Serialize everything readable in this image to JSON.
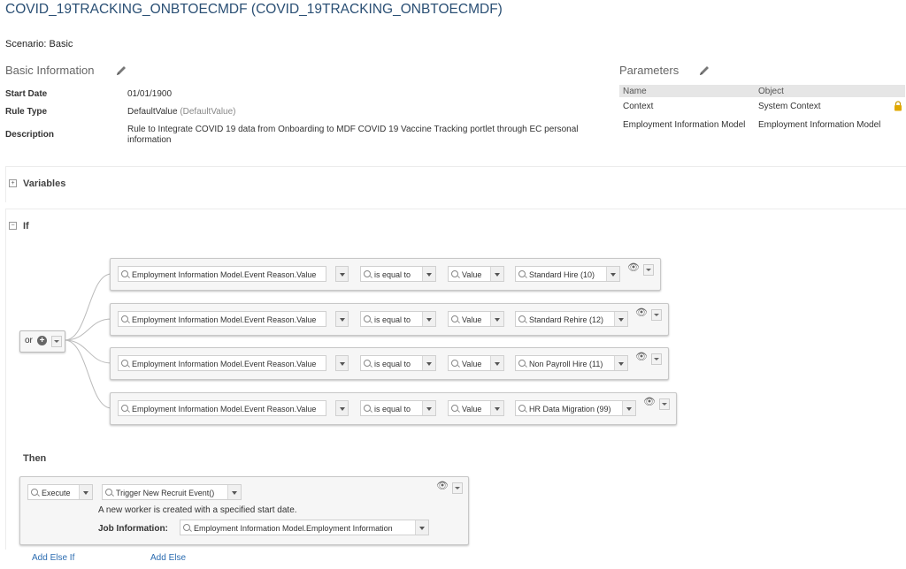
{
  "title": "COVID_19TRACKING_ONBTOECMDF (COVID_19TRACKING_ONBTOECMDF)",
  "scenario": "Scenario: Basic",
  "basic_info": {
    "heading": "Basic Information",
    "start_date_label": "Start Date",
    "start_date_value": "01/01/1900",
    "rule_type_label": "Rule Type",
    "rule_type_value": "DefaultValue",
    "rule_type_sub": "(DefaultValue)",
    "description_label": "Description",
    "description_value": "Rule to Integrate COVID 19 data from Onboarding to MDF COVID 19 Vaccine Tracking portlet through EC personal information"
  },
  "parameters": {
    "heading": "Parameters",
    "col_name": "Name",
    "col_object": "Object",
    "rows": [
      {
        "name": "Context",
        "object": "System Context"
      },
      {
        "name": "Employment Information Model",
        "object": "Employment Information Model"
      }
    ]
  },
  "variables": {
    "label": "Variables",
    "toggle": "+"
  },
  "if_section": {
    "label": "If",
    "toggle": "−",
    "operator": "or"
  },
  "conditions": [
    {
      "field": "Employment Information Model.Event Reason.Value",
      "op": "is equal to",
      "type": "Value",
      "value": "Standard Hire (10)"
    },
    {
      "field": "Employment Information Model.Event Reason.Value",
      "op": "is equal to",
      "type": "Value",
      "value": "Standard Rehire (12)"
    },
    {
      "field": "Employment Information Model.Event Reason.Value",
      "op": "is equal to",
      "type": "Value",
      "value": "Non Payroll Hire (11)"
    },
    {
      "field": "Employment Information Model.Event Reason.Value",
      "op": "is equal to",
      "type": "Value",
      "value": "HR Data Migration (99)"
    }
  ],
  "then": {
    "label": "Then",
    "action": "Execute",
    "function": "Trigger New Recruit Event()",
    "description": "A new worker is created with a specified start date.",
    "job_info_label": "Job Information:",
    "job_info_value": "Employment Information Model.Employment Information"
  },
  "links": {
    "add_else_if": "Add Else If",
    "add_else": "Add Else"
  },
  "colors": {
    "title": "#2a4f74",
    "link": "#2a6bb0",
    "lock": "#e0a800"
  }
}
